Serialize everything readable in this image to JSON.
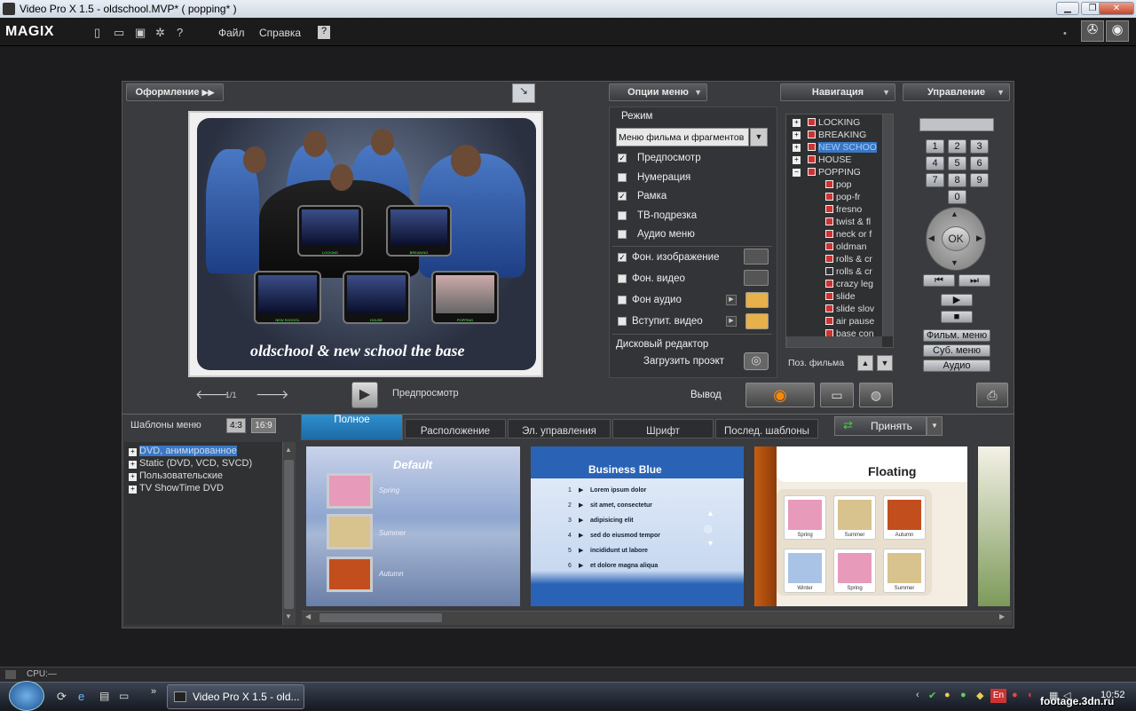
{
  "titlebar": {
    "title": "Video Pro X 1.5 - oldschool.MVP* ( popping* )"
  },
  "appbar": {
    "logo": "MAGIX",
    "menus": [
      "Файл",
      "Справка"
    ]
  },
  "header": {
    "design": "Оформление",
    "menu_options": "Опции меню",
    "navigation": "Навигация",
    "control": "Управление"
  },
  "preview": {
    "title": "oldschool & new school the base",
    "page": "1/1",
    "preview_label": "Предпросмотр",
    "thumbs": [
      "LOCKING",
      "BREAKING",
      "NEW SCHOOL",
      "HOUSE",
      "POPPING"
    ]
  },
  "options": {
    "mode_label": "Режим",
    "mode_value": "Меню фильма и фрагментов",
    "checks": [
      {
        "label": "Предпосмотр",
        "checked": true
      },
      {
        "label": "Нумерация",
        "checked": false
      },
      {
        "label": "Рамка",
        "checked": true
      },
      {
        "label": "ТВ-подрезка",
        "checked": false
      },
      {
        "label": "Аудио меню",
        "checked": false
      }
    ],
    "bg_image": "Фон. изображение",
    "bg_video": "Фон. видео",
    "bg_audio": "Фон аудио",
    "intro_video": "Вступит. видео",
    "disc_editor": "Дисковый редактор",
    "load_project": "Загрузить проэкт",
    "output": "Вывод"
  },
  "navigation": {
    "items": [
      "LOCKING",
      "BREAKING",
      "NEW SCHOO",
      "HOUSE",
      "POPPING"
    ],
    "children": [
      "pop",
      "pop-fr",
      "fresno",
      "twist & fl",
      "neck or f",
      "oldman",
      "rolls & cr",
      "rolls & cr",
      "crazy leg",
      "slide",
      "slide slov",
      "air pause",
      "base con"
    ],
    "film_pos": "Поз. фильма"
  },
  "control": {
    "keys": [
      "1",
      "2",
      "3",
      "4",
      "5",
      "6",
      "7",
      "8",
      "9",
      "0"
    ],
    "ok": "OK",
    "film_menu": "Фильм. меню",
    "sub_menu": "Суб. меню",
    "audio": "Аудио"
  },
  "templates": {
    "label": "Шаблоны меню",
    "ratio_43": "4:3",
    "ratio_169": "16:9",
    "tabs": [
      "Полное",
      "Расположение",
      "Эл. управления",
      "Шрифт",
      "Послед. шаблоны"
    ],
    "accept": "Принять",
    "list": [
      "DVD, анимированное",
      "Static (DVD, VCD, SVCD)",
      "Пользовательские",
      "TV ShowTime DVD"
    ],
    "previews": {
      "default": {
        "title": "Default",
        "items": [
          "Spring",
          "Summer",
          "Autumn"
        ]
      },
      "business": {
        "title": "Business Blue",
        "items": [
          "Lorem ipsum dolor",
          "sit amet, consectetur",
          "adipisicing elit",
          "sed do eiusmod tempor",
          "incididunt ut labore",
          "et dolore magna aliqua"
        ]
      },
      "floating": {
        "title": "Floating",
        "items": [
          "Spring",
          "Summer",
          "Autumn",
          "Winter",
          "Spring",
          "Summer"
        ]
      }
    }
  },
  "status": {
    "cpu": "CPU:—"
  },
  "taskbar": {
    "task": "Video Pro X 1.5 - old...",
    "lang": "En",
    "clock": "10:52",
    "watermark": "footage.3dn.ru"
  }
}
